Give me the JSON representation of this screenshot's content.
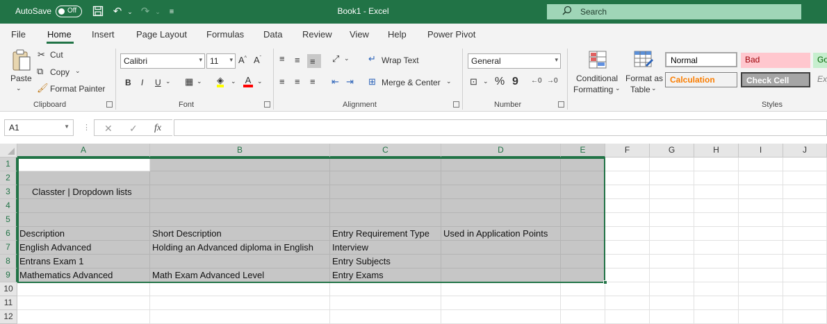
{
  "titlebar": {
    "autosave_label": "AutoSave",
    "autosave_state": "Off",
    "document_title": "Book1  -  Excel",
    "search_placeholder": "Search"
  },
  "menu": {
    "tabs": [
      "File",
      "Home",
      "Insert",
      "Page Layout",
      "Formulas",
      "Data",
      "Review",
      "View",
      "Help",
      "Power Pivot"
    ],
    "active_tab": "Home"
  },
  "ribbon": {
    "clipboard": {
      "label": "Clipboard",
      "paste": "Paste",
      "cut": "Cut",
      "copy": "Copy",
      "format_painter": "Format Painter"
    },
    "font": {
      "label": "Font",
      "font_name": "Calibri",
      "font_size": "11",
      "bold": "B",
      "italic": "I",
      "underline": "U"
    },
    "alignment": {
      "label": "Alignment",
      "wrap_text": "Wrap Text",
      "merge_center": "Merge & Center"
    },
    "number": {
      "label": "Number",
      "format": "General",
      "percent": "%",
      "comma": "9"
    },
    "styles_group": {
      "label": "Styles",
      "conditional_formatting": [
        "Conditional",
        "Formatting"
      ],
      "format_as_table": [
        "Format as",
        "Table"
      ],
      "cell_styles": [
        {
          "label": "Normal",
          "bg": "#ffffff",
          "fg": "#000000",
          "border": "#a6a6a6"
        },
        {
          "label": "Bad",
          "bg": "#ffc7ce",
          "fg": "#9c0006",
          "border": "#ffc7ce"
        },
        {
          "label": "Good",
          "bg": "#c6efce",
          "fg": "#006100",
          "border": "#c6efce"
        },
        {
          "label": "Calculation",
          "bg": "#f2f2f2",
          "fg": "#fa7d00",
          "border": "#7f7f7f"
        },
        {
          "label": "Check Cell",
          "bg": "#a5a5a5",
          "fg": "#ffffff",
          "border": "#3f3f3f"
        },
        {
          "label": "Explanatory ...",
          "bg": "#f3f3f3",
          "fg": "#7f7f7f",
          "border": "#f3f3f3"
        }
      ]
    }
  },
  "formula_bar": {
    "name_box": "A1",
    "cancel": "✕",
    "enter": "✓",
    "fx": "fx",
    "value": ""
  },
  "sheet": {
    "columns": [
      "A",
      "B",
      "C",
      "D",
      "E",
      "F",
      "G",
      "H",
      "I",
      "J"
    ],
    "rows": [
      "1",
      "2",
      "3",
      "4",
      "5",
      "6",
      "7",
      "8",
      "9",
      "10",
      "11",
      "12"
    ],
    "selected_range": "A1:E9",
    "cells": {
      "A3": "     Classter | Dropdown lists",
      "A6": "Description",
      "B6": "Short Description",
      "C6": "Entry Requirement Type",
      "D6": "Used in Application Points",
      "A7": "English Advanced",
      "B7": "Holding an Advanced diploma in English",
      "C7": "Interview",
      "A8": "Entrans Exam 1",
      "C8": "Entry Subjects",
      "A9": "Mathematics Advanced",
      "B9": "Math Exam Advanced Level",
      "C9": "Entry Exams"
    }
  },
  "colors": {
    "accent": "#217346",
    "selection": "#c6c6c6"
  }
}
